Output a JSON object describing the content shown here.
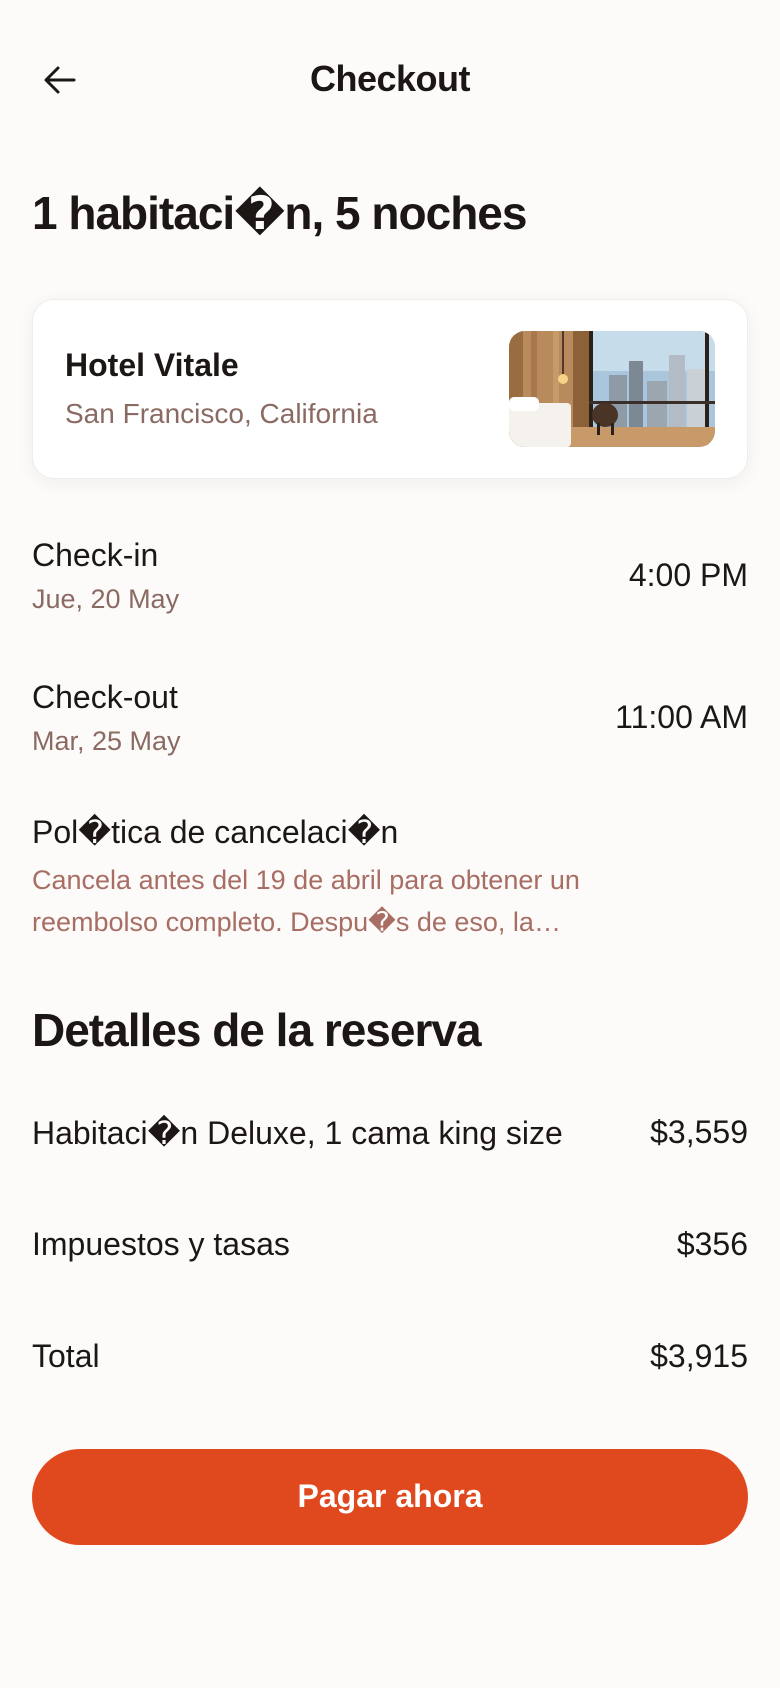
{
  "header": {
    "back_icon": "arrow-left-icon",
    "title": "Checkout"
  },
  "summary": {
    "title": "1 habitaci�n, 5 noches"
  },
  "hotel": {
    "name": "Hotel Vitale",
    "location": "San Francisco, California"
  },
  "check_in": {
    "label": "Check-in",
    "date": "Jue, 20 May",
    "time": "4:00 PM"
  },
  "check_out": {
    "label": "Check-out",
    "date": "Mar, 25 May",
    "time": "11:00 AM"
  },
  "policy": {
    "title": "Pol�tica de cancelaci�n",
    "text": "Cancela antes del 19 de abril para obtener un reembolso completo. Despu�s de eso, la…"
  },
  "details": {
    "title": "Detalles de la reserva",
    "rows": [
      {
        "label": "Habitaci�n Deluxe, 1 cama king size",
        "value": "$3,559"
      },
      {
        "label": "Impuestos y tasas",
        "value": "$356"
      },
      {
        "label": "Total",
        "value": "$3,915"
      }
    ]
  },
  "cta": {
    "label": "Pagar ahora",
    "color": "#e0491e"
  }
}
